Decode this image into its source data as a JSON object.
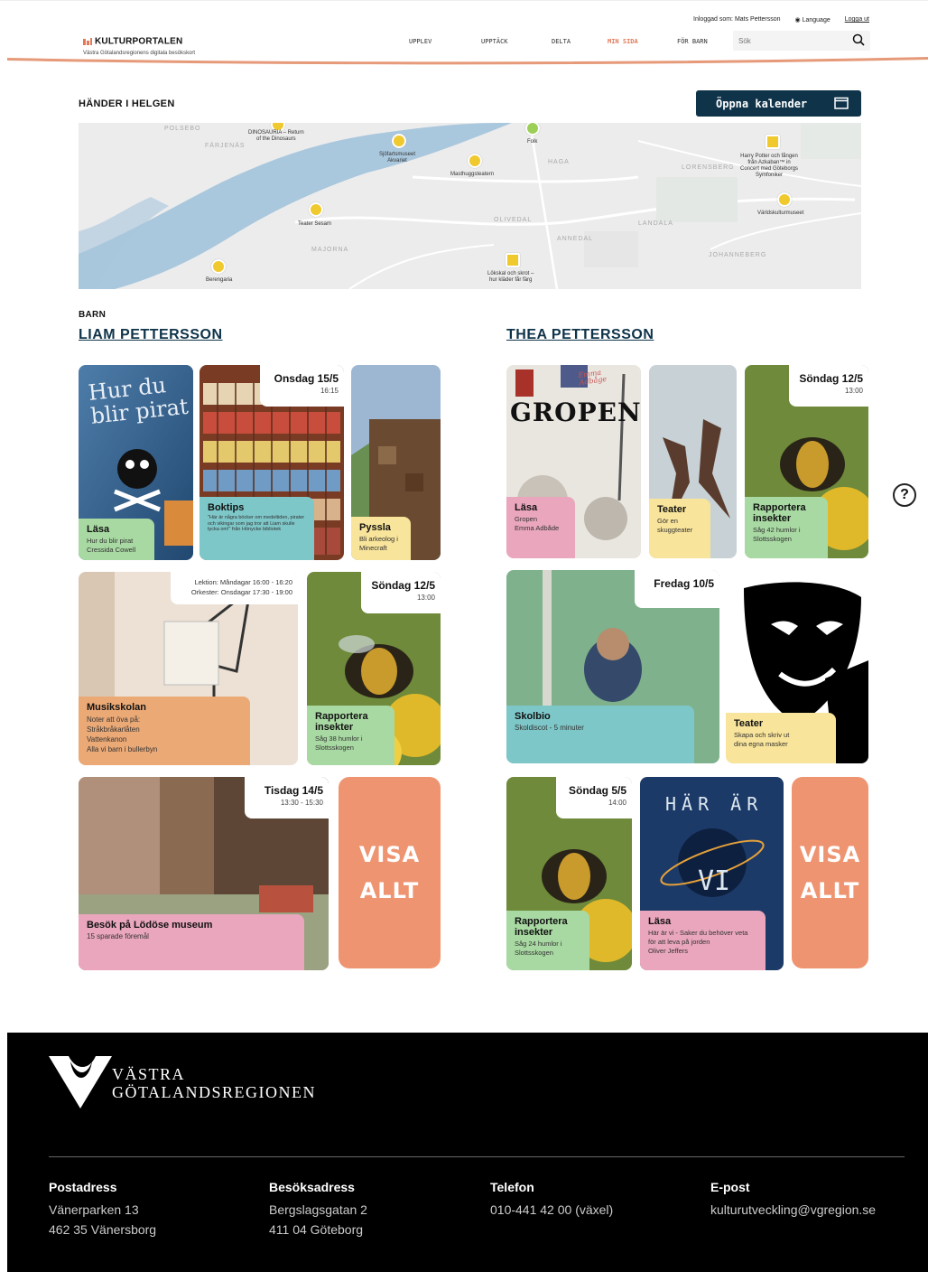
{
  "header": {
    "logged_in": "Inloggad som: Mats Pettersson",
    "language": "Language",
    "logout": "Logga ut",
    "logo_title": "KULTURPORTALEN",
    "logo_sub": "Västra Götalandsregionens digitala besökskort",
    "nav": [
      "UPPLEV",
      "UPPTÄCK",
      "DELTA",
      "MIN SIDA",
      "FÖR BARN"
    ],
    "search_placeholder": "Sök",
    "accent_color": "#e27a5a"
  },
  "weekend": {
    "title": "HÄNDER I HELGEN",
    "calendar_button": "Öppna kalender",
    "map_areas": [
      "POLSEBO",
      "FÄRJENÄS",
      "HAGA",
      "LORENSBERG",
      "OLIVEDAL",
      "ANNEDAL",
      "LANDALA",
      "MAJORNA",
      "JOHANNEBERG"
    ],
    "pins": [
      {
        "label": "DINOSAURIA – Return\nof the Dinosaurs"
      },
      {
        "label": "Sjöfartsmuseet\nAkvariet"
      },
      {
        "label": "Folk"
      },
      {
        "label": "Masthuggsteatern"
      },
      {
        "label": "Harry Potter och fången\nfrån Azkaban™ in\nConcert med Göteborgs\nSymfoniker"
      },
      {
        "label": "Världskulturmuseet"
      },
      {
        "label": "Teater Sesam"
      },
      {
        "label": "Lökskal och skrot –\nhur kläder får färg"
      },
      {
        "label": "Berengaria"
      }
    ]
  },
  "children_label": "BARN",
  "children": [
    {
      "name": "LIAM PETTERSSON",
      "cards": [
        {
          "title": "Läsa",
          "sub": "Hur du blir pirat\nCressida Cowell"
        },
        {
          "title": "Boktips",
          "sub": "\"Här är några böcker om medeltiden, pirater och vikingar som jag tror att Liam skulle tycka om!\" från Hönycke bibliotek",
          "date": "Onsdag 15/5",
          "time": "16:15"
        },
        {
          "title": "Pyssla",
          "sub": "Bli arkeolog i\nMinecraft"
        },
        {
          "title": "Musikskolan",
          "sub": "Noter att öva på:\nStråkbråkarlåten\nVattenkanon\nAlla vi barn i bullerbyn",
          "lesson": "Lektion: Måndagar 16:00 - 16:20",
          "orchestra": "Orkester: Onsdagar 17:30 - 19:00"
        },
        {
          "title": "Rapportera insekter",
          "sub": "Såg 38 humlor i\nSlottsskogen",
          "date": "Söndag 12/5",
          "time": "13:00"
        },
        {
          "title": "Besök på Lödöse museum",
          "sub": "15 sparade föremål",
          "date": "Tisdag 14/5",
          "time": "13:30 - 15:30"
        }
      ],
      "show_all": [
        "VISA",
        "ALLT"
      ]
    },
    {
      "name": "THEA PETTERSSON",
      "cards": [
        {
          "title": "Läsa",
          "sub": "Gropen\nEmma Adbåde",
          "cover_text": "GROPEN",
          "cover_author": "Emma\nAdbåge"
        },
        {
          "title": "Teater",
          "sub": "Gör en\nskuggteater"
        },
        {
          "title": "Rapportera insekter",
          "sub": "Såg 42 humlor i\nSlottsskogen",
          "date": "Söndag 12/5",
          "time": "13:00"
        },
        {
          "title": "Skolbio",
          "sub": "Skoldiscot - 5 minuter",
          "date": "Fredag 10/5"
        },
        {
          "title": "Teater",
          "sub": "Skapa och skriv ut\ndina egna masker"
        },
        {
          "title": "Rapportera insekter",
          "sub": "Såg 24 humlor i\nSlottsskogen",
          "date": "Söndag 5/5",
          "time": "14:00"
        },
        {
          "title": "Läsa",
          "sub": "Här är vi - Saker du behöver veta för att leva på jorden\nOliver Jeffers",
          "cover_text_top": "HÄR ÄR",
          "cover_text_bottom": "VI"
        }
      ],
      "show_all": [
        "VISA",
        "ALLT"
      ]
    }
  ],
  "book_cover": {
    "title": "Hur du blir pirat"
  },
  "footer": {
    "org_line1": "VÄSTRA",
    "org_line2": "GÖTALANDSREGIONEN",
    "columns": [
      {
        "heading": "Postadress",
        "lines": [
          "Vänerparken 13",
          "462 35 Vänersborg"
        ]
      },
      {
        "heading": "Besöksadress",
        "lines": [
          "Bergslagsgatan 2",
          "411 04 Göteborg"
        ]
      },
      {
        "heading": "Telefon",
        "lines": [
          "010-441 42 00 (växel)"
        ]
      },
      {
        "heading": "E-post",
        "lines": [
          "kulturutveckling@vgregion.se"
        ]
      }
    ]
  },
  "help_label": "?"
}
